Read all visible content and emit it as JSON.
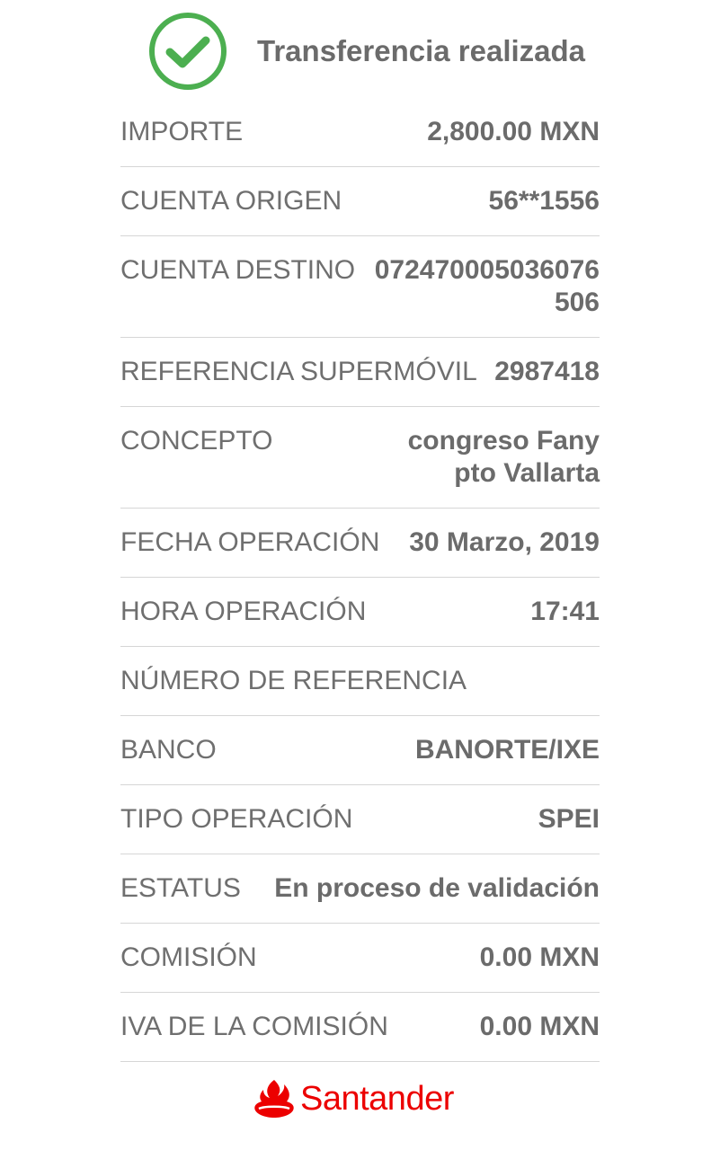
{
  "header": {
    "title": "Transferencia realizada",
    "icon": "check-circle-icon",
    "icon_color": "#4caf50"
  },
  "rows": [
    {
      "label": "IMPORTE",
      "value": "2,800.00 MXN"
    },
    {
      "label": "CUENTA ORIGEN",
      "value": "56**1556"
    },
    {
      "label": "CUENTA DESTINO",
      "value": "072470005036076506"
    },
    {
      "label": "REFERENCIA SUPERMÓVIL",
      "value": "2987418"
    },
    {
      "label": "CONCEPTO",
      "value": "congreso Fany pto Vallarta"
    },
    {
      "label": "FECHA OPERACIÓN",
      "value": "30 Marzo, 2019"
    },
    {
      "label": "HORA OPERACIÓN",
      "value": "17:41"
    },
    {
      "label": "NÚMERO DE REFERENCIA",
      "value": ""
    },
    {
      "label": "BANCO",
      "value": "BANORTE/IXE"
    },
    {
      "label": "TIPO OPERACIÓN",
      "value": "SPEI"
    },
    {
      "label": "ESTATUS",
      "value": "En proceso de validación"
    },
    {
      "label": "COMISIÓN",
      "value": "0.00 MXN"
    },
    {
      "label": "IVA DE LA COMISIÓN",
      "value": "0.00 MXN"
    }
  ],
  "footer": {
    "brand": "Santander",
    "brand_icon": "flame-icon",
    "brand_color": "#ec0000"
  }
}
